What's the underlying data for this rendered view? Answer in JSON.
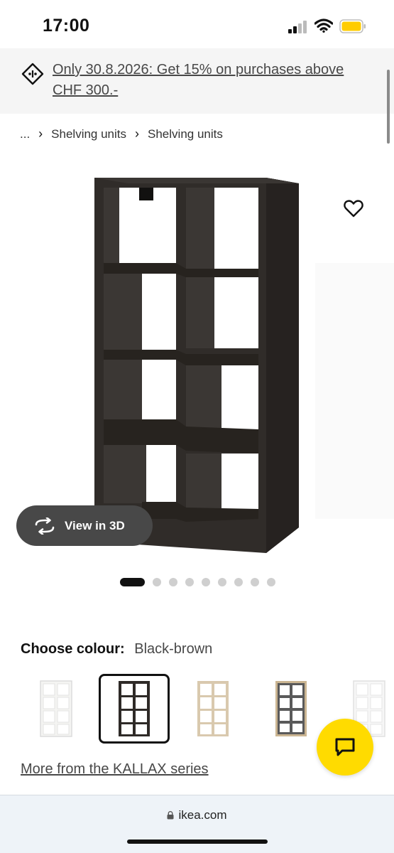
{
  "status_bar": {
    "time": "17:00"
  },
  "promo": {
    "text": "Only 30.8.2026: Get 15% on purchases above CHF 300.-"
  },
  "breadcrumb": {
    "ellipsis": "...",
    "items": [
      "Shelving units",
      "Shelving units"
    ]
  },
  "product": {
    "view_3d_label": "View in 3D",
    "image_count": 9,
    "active_image": 1
  },
  "colour": {
    "label": "Choose colour:",
    "selected": "Black-brown",
    "options": [
      {
        "name": "white",
        "color": "#f4f4f2"
      },
      {
        "name": "black-brown",
        "color": "#2e2a27"
      },
      {
        "name": "white stained oak effect",
        "color": "#d9c9ae"
      },
      {
        "name": "grey/wood effect",
        "color": "#5a5a5a"
      },
      {
        "name": "high-gloss white",
        "color": "#f7f7f7"
      }
    ]
  },
  "series_link": "More from the KALLAX series",
  "browser": {
    "url": "ikea.com"
  },
  "colors": {
    "accent_yellow": "#ffdb00",
    "dark_pill": "#484848",
    "banner_bg": "#f5f5f5"
  }
}
